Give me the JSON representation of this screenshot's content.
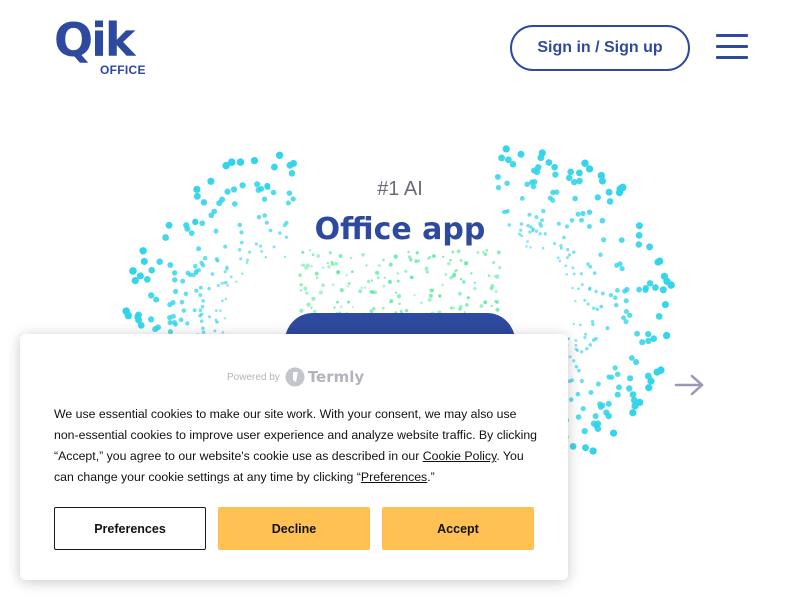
{
  "header": {
    "logo_mark": "Qik",
    "logo_sub": "OFFICE",
    "signin_label": "Sign in / Sign up"
  },
  "hero": {
    "kicker": "#1 AI",
    "title": "Office app",
    "colors": {
      "primary": "#2e4a9e",
      "dot_cyan": "#2fd3ea",
      "dot_green": "#5ce8a0"
    }
  },
  "cookie_banner": {
    "powered_by": "Powered by",
    "brand": "Termly",
    "text_part1": "We use essential cookies to make our site work. With your consent, we may also use non-essential cookies to improve user experience and analyze website traffic. By clicking “Accept,” you agree to our website's cookie use as described in our ",
    "cookie_policy_link": "Cookie Policy",
    "text_part2": ". You can change your cookie settings at any time by clicking “",
    "preferences_link": "Preferences",
    "text_part3": ".”",
    "buttons": {
      "preferences": "Preferences",
      "decline": "Decline",
      "accept": "Accept"
    },
    "accent_color": "#ffc154"
  },
  "icons": {
    "menu": "hamburger-menu-icon",
    "next": "arrow-right-icon",
    "termly": "termly-logo-icon"
  }
}
